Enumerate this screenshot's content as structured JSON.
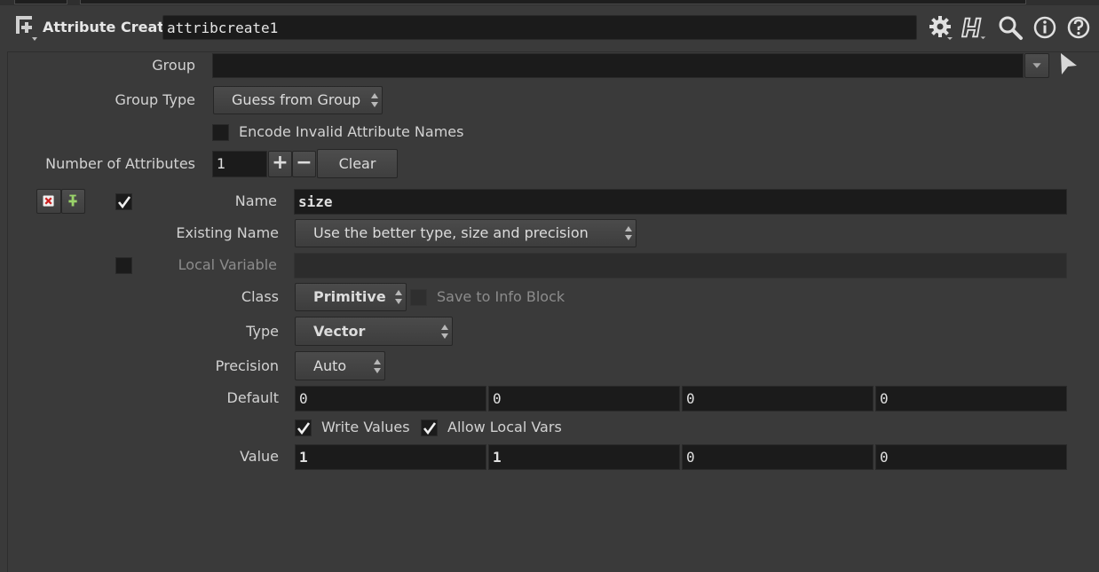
{
  "header": {
    "node_type": "Attribute Create",
    "node_name": "attribcreate1",
    "icons": [
      "gear-icon",
      "houdini-help-icon",
      "search-icon",
      "info-icon",
      "help-icon"
    ]
  },
  "params": {
    "group": {
      "label": "Group",
      "value": ""
    },
    "group_type": {
      "label": "Group Type",
      "value": "Guess from Group"
    },
    "encode_invalid": {
      "label": "Encode Invalid Attribute Names",
      "checked": false
    },
    "num_attributes": {
      "label": "Number of Attributes",
      "value": "1",
      "plus": "+",
      "minus": "−",
      "clear": "Clear"
    },
    "attr": {
      "enabled": true,
      "name": {
        "label": "Name",
        "value": "size"
      },
      "existing_name": {
        "label": "Existing Name",
        "value": "Use the better type, size and precision"
      },
      "local_variable": {
        "label": "Local Variable",
        "value": "",
        "checked": false
      },
      "class": {
        "label": "Class",
        "value": "Primitive"
      },
      "save_info": {
        "label": "Save to Info Block",
        "checked": false
      },
      "type": {
        "label": "Type",
        "value": "Vector"
      },
      "precision": {
        "label": "Precision",
        "value": "Auto"
      },
      "default": {
        "label": "Default",
        "values": [
          "0",
          "0",
          "0",
          "0"
        ]
      },
      "write_values": {
        "label": "Write Values",
        "checked": true
      },
      "allow_local_vars": {
        "label": "Allow Local Vars",
        "checked": true
      },
      "value": {
        "label": "Value",
        "values": [
          "1",
          "1",
          "0",
          "0"
        ]
      }
    }
  }
}
